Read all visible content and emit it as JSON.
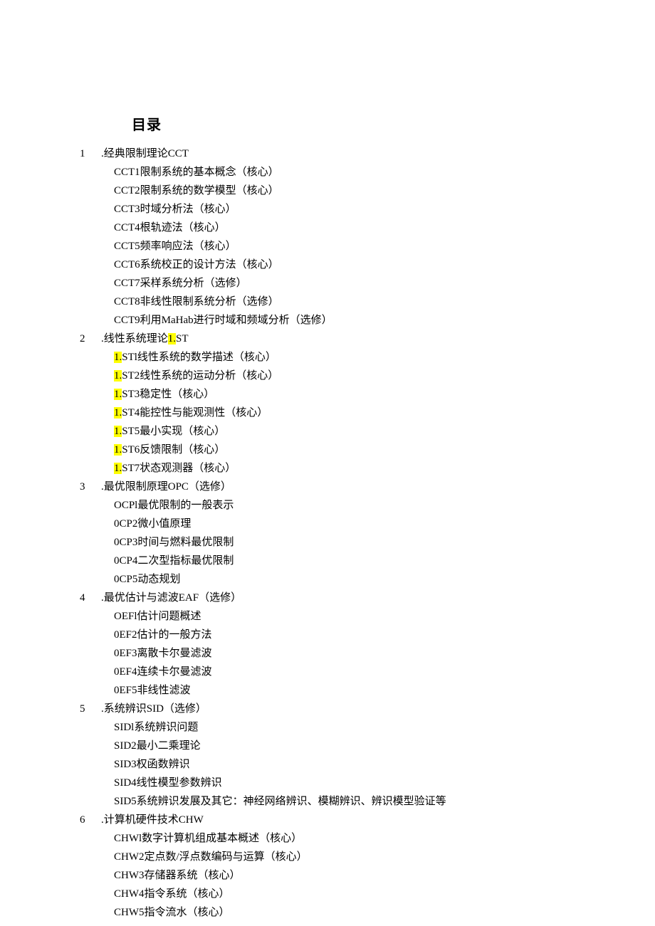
{
  "title": "目录",
  "sections": [
    {
      "num": "1",
      "title_parts": [
        {
          "text": ".经典限制理论CCT",
          "hl": false
        }
      ],
      "items": [
        [
          {
            "text": "CCT1限制系统的基本概念（核心）",
            "hl": false
          }
        ],
        [
          {
            "text": "CCT2限制系统的数学模型（核心）",
            "hl": false
          }
        ],
        [
          {
            "text": "CCT3时域分析法（核心）",
            "hl": false
          }
        ],
        [
          {
            "text": "CCT4根轨迹法（核心）",
            "hl": false
          }
        ],
        [
          {
            "text": "CCT5频率响应法（核心）",
            "hl": false
          }
        ],
        [
          {
            "text": "CCT6系统校正的设计方法（核心）",
            "hl": false
          }
        ],
        [
          {
            "text": "CCT7采样系统分析（选修）",
            "hl": false
          }
        ],
        [
          {
            "text": "CCT8非线性限制系统分析（选修）",
            "hl": false
          }
        ],
        [
          {
            "text": "CCT9利用MaHab进行时域和频域分析（选修）",
            "hl": false
          }
        ]
      ]
    },
    {
      "num": "2",
      "title_parts": [
        {
          "text": ".线性系统理论",
          "hl": false
        },
        {
          "text": "1.",
          "hl": true
        },
        {
          "text": "ST",
          "hl": false
        }
      ],
      "items": [
        [
          {
            "text": "1.",
            "hl": true
          },
          {
            "text": "STl线性系统的数学描述（核心）",
            "hl": false
          }
        ],
        [
          {
            "text": "1.",
            "hl": true
          },
          {
            "text": "ST2线性系统的运动分析（核心）",
            "hl": false
          }
        ],
        [
          {
            "text": "1.",
            "hl": true
          },
          {
            "text": "ST3稳定性（核心）",
            "hl": false
          }
        ],
        [
          {
            "text": "1.",
            "hl": true
          },
          {
            "text": "ST4能控性与能观测性（核心）",
            "hl": false
          }
        ],
        [
          {
            "text": "1.",
            "hl": true
          },
          {
            "text": "ST5最小实现（核心）",
            "hl": false
          }
        ],
        [
          {
            "text": "1.",
            "hl": true
          },
          {
            "text": "ST6反馈限制（核心）",
            "hl": false
          }
        ],
        [
          {
            "text": "1.",
            "hl": true
          },
          {
            "text": "ST7状态观测器（核心）",
            "hl": false
          }
        ]
      ]
    },
    {
      "num": "3",
      "title_parts": [
        {
          "text": ".最优限制原理OPC（选修）",
          "hl": false
        }
      ],
      "items": [
        [
          {
            "text": "OCPl最优限制的一般表示",
            "hl": false
          }
        ],
        [
          {
            "text": "0CP2微小值原理",
            "hl": false
          }
        ],
        [
          {
            "text": "0CP3时间与燃料最优限制",
            "hl": false
          }
        ],
        [
          {
            "text": "0CP4二次型指标最优限制",
            "hl": false
          }
        ],
        [
          {
            "text": "0CP5动态规划",
            "hl": false
          }
        ]
      ]
    },
    {
      "num": "4",
      "title_parts": [
        {
          "text": ".最优估计与滤波EAF（选修）",
          "hl": false
        }
      ],
      "items": [
        [
          {
            "text": "OEFl估计问题概述",
            "hl": false
          }
        ],
        [
          {
            "text": "0EF2估计的一般方法",
            "hl": false
          }
        ],
        [
          {
            "text": "0EF3离散卡尔曼滤波",
            "hl": false
          }
        ],
        [
          {
            "text": "0EF4连续卡尔曼滤波",
            "hl": false
          }
        ],
        [
          {
            "text": "0EF5非线性滤波",
            "hl": false
          }
        ]
      ]
    },
    {
      "num": "5",
      "title_parts": [
        {
          "text": ".系统辨识SID（选修）",
          "hl": false
        }
      ],
      "items": [
        [
          {
            "text": "SIDl系统辨识问题",
            "hl": false
          }
        ],
        [
          {
            "text": "SID2最小二乘理论",
            "hl": false
          }
        ],
        [
          {
            "text": "SID3权函数辨识",
            "hl": false
          }
        ],
        [
          {
            "text": "SID4线性模型参数辨识",
            "hl": false
          }
        ],
        [
          {
            "text": "SID5系统辨识发展及其它：神经网络辨识、模糊辨识、辨识模型验证等",
            "hl": false
          }
        ]
      ]
    },
    {
      "num": "6",
      "title_parts": [
        {
          "text": ".计算机硬件技术CHW",
          "hl": false
        }
      ],
      "items": [
        [
          {
            "text": "CHWl数字计算机组成基本概述（核心）",
            "hl": false
          }
        ],
        [
          {
            "text": "CHW2定点数/浮点数编码与运算（核心）",
            "hl": false
          }
        ],
        [
          {
            "text": "CHW3存储器系统（核心）",
            "hl": false
          }
        ],
        [
          {
            "text": "CHW4指令系统（核心）",
            "hl": false
          }
        ],
        [
          {
            "text": "CHW5指令流水（核心）",
            "hl": false
          }
        ]
      ]
    }
  ]
}
